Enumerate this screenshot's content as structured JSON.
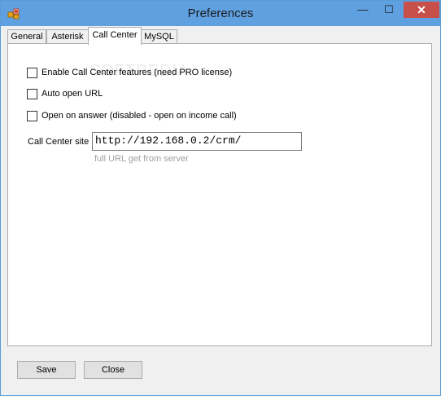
{
  "window": {
    "title": "Preferences",
    "controls": {
      "minimize": "—",
      "maximize": "☐",
      "close": "✕"
    }
  },
  "tabs": [
    {
      "label": "General",
      "active": false
    },
    {
      "label": "Asterisk",
      "active": false
    },
    {
      "label": "Call Center",
      "active": true
    },
    {
      "label": "MySQL",
      "active": false
    }
  ],
  "call_center": {
    "options": [
      {
        "label": "Enable Call Center features (need PRO license)",
        "checked": false
      },
      {
        "label": "Auto open URL",
        "checked": false
      },
      {
        "label": "Open on answer (disabled - open on income call)",
        "checked": false
      }
    ],
    "site_label": "Call Center site",
    "site_value": "http://192.168.0.2/crm/",
    "site_hint": "full URL get from server"
  },
  "buttons": {
    "save": "Save",
    "close": "Close"
  },
  "colors": {
    "titlebar": "#5ea0e0",
    "close_button": "#c7514a",
    "hint_text": "#a0a0a0"
  }
}
